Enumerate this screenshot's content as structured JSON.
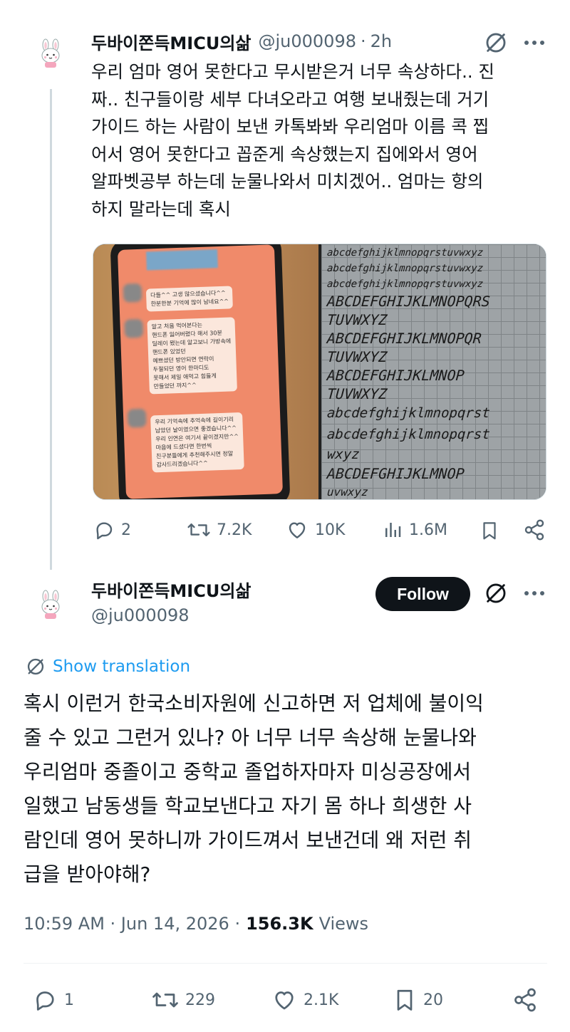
{
  "tweet1": {
    "author_name": "두바이쫀득MICU의삶",
    "handle": "@ju000098",
    "separator": "·",
    "time": "2h",
    "text_lines": [
      "우리 엄마 영어 못한다고 무시받은거 너무 속상하다.. 진",
      "짜.. 친구들이랑 세부 다녀오라고 여행 보내줬는데 거기",
      "가이드 하는 사람이 보낸 카톡봐봐 우리엄마 이름 콕 찝",
      "어서 영어 못한다고 꼽준게 속상했는지 집에와서 영어",
      "알파벳공부 하는데 눈물나와서 미치겠어.. 엄마는 항의",
      "하지 말라는데 혹시"
    ],
    "media": {
      "chat_lines": [
        [
          "다들^^ 고생 많으셨습니다^^",
          "한분한분 기억에 많이 남네요^^"
        ],
        [
          "알고 처음 먹어본다는",
          "핸드폰 잃어버렸다 해서 30분",
          "딜레이 됐는데 알고보니 가방속에",
          "핸드폰 있었던",
          "예쁘셨던      방안되면 연락이",
          "두절되던      영어 한마디도",
          "못해서 제일 애먹고 힘들게",
          "만들었던      까지^^"
        ],
        [
          "우리 기억속에 추억속에 길이기리",
          "남았던 날이였으면 좋겠습니다^^",
          "우리 인연은 여기서 끝이겠지만^^",
          "마음에 드셨다면 한번씩",
          "친구분들에게 추천해주시면 정말",
          "감사드리겠습니다^^"
        ]
      ],
      "handwriting_lines": [
        "abcdefghijklmnopqrstuvwxyz",
        "abcdefghijklmnopqrstuvwxyz",
        "abcdefghijklmnopqrstuvwxyz",
        "ABCDEFGHIJKLMNOPQRS",
        "TUVWXYZ",
        "ABCDEFGHIJKLMNOPQR",
        "TUVWXYZ",
        "ABCDEFGHIJKLMNOP",
        "TUVWXYZ",
        "abcdefghijklmnopqrst",
        "abcdefghijklmnopqrst",
        "wxyz",
        "ABCDEFGHIJKLMNOP",
        "uvwxyz"
      ]
    },
    "actions": {
      "replies": "2",
      "reposts": "7.2K",
      "likes": "10K",
      "views": "1.6M"
    }
  },
  "tweet2": {
    "author_name": "두바이쫀득MICU의삶",
    "handle": "@ju000098",
    "follow_label": "Follow",
    "show_translation": "Show translation",
    "text_lines": [
      "혹시 이런거 한국소비자원에 신고하면 저 업체에 불이익",
      "줄 수 있고 그런거 있나? 아 너무 너무 속상해 눈물나와",
      "우리엄마 중졸이고 중학교 졸업하자마자 미싱공장에서",
      "일했고 남동생들 학교보낸다고 자기 몸 하나 희생한 사",
      "람인데 영어 못하니까 가이드껴서 보낸건데 왜 저런 취",
      "급을 받아야해?"
    ],
    "timestamp": "10:59 AM · Jun 14, 2026 ·",
    "views_count": "156.3K",
    "views_label": "Views",
    "actions": {
      "replies": "1",
      "reposts": "229",
      "likes": "2.1K",
      "bookmarks": "20"
    }
  },
  "icons": {
    "avatar": "bunny-avatar-icon",
    "grok": "grok-icon",
    "more": "more-icon",
    "reply": "reply-icon",
    "repost": "repost-icon",
    "like": "like-icon",
    "views": "views-icon",
    "bookmark": "bookmark-icon",
    "share": "share-icon",
    "translate": "translate-icon"
  },
  "colors": {
    "text": "#0f1419",
    "secondary": "#536471",
    "accent": "#1d9bf0",
    "thread_line": "#cfd9de"
  }
}
